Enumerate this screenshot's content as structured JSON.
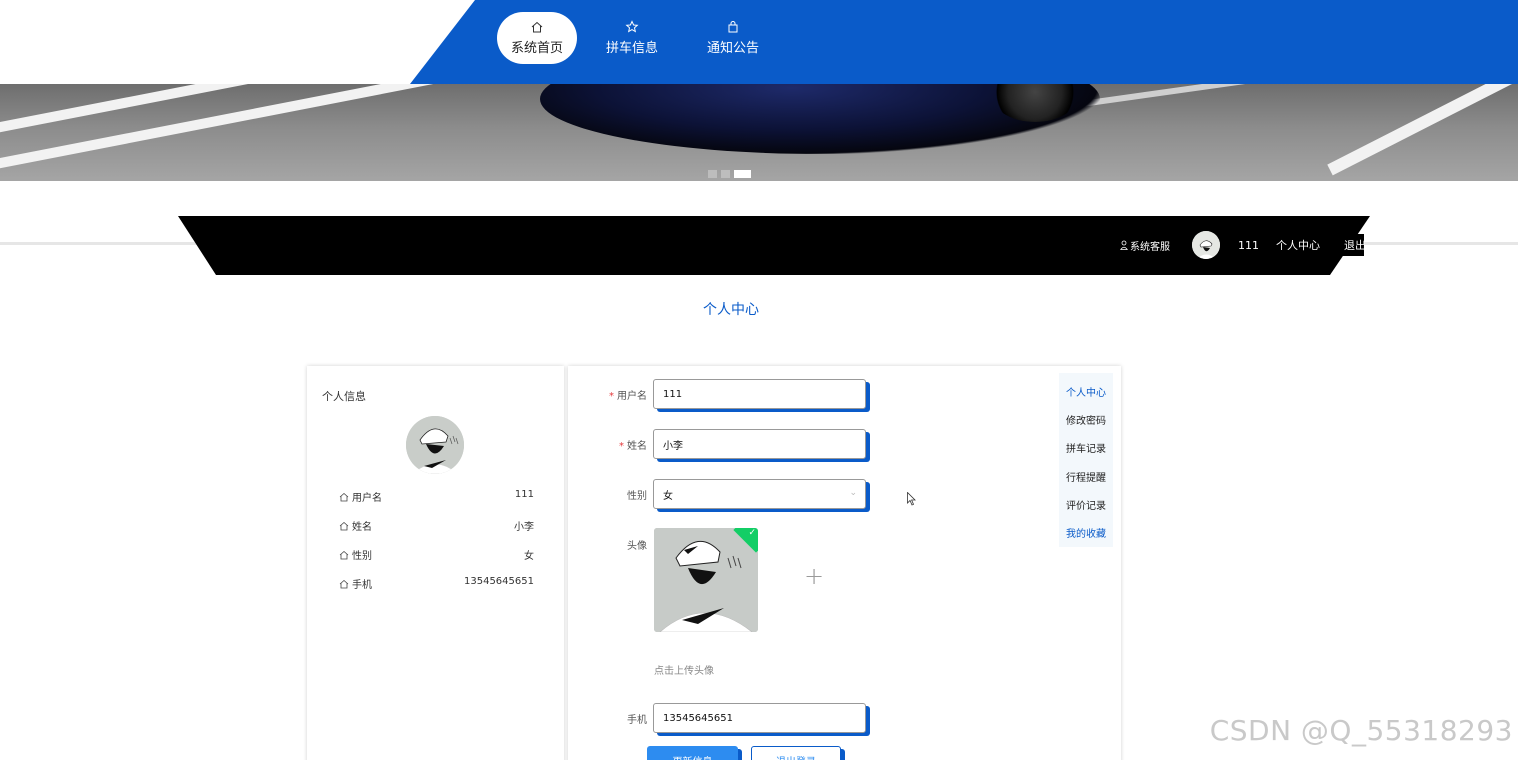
{
  "nav": {
    "items": [
      {
        "label": "系统首页",
        "icon": "home-icon",
        "active": true
      },
      {
        "label": "拼车信息",
        "icon": "star-icon",
        "active": false
      },
      {
        "label": "通知公告",
        "icon": "bag-icon",
        "active": false
      }
    ],
    "accent_color": "#0a5bc9"
  },
  "carousel": {
    "slides": 3,
    "active_index": 2
  },
  "userbar": {
    "service_label": "系统客服",
    "username": "111",
    "center_label": "个人中心",
    "logout_label": "退出"
  },
  "page": {
    "title": "个人中心"
  },
  "profile": {
    "title": "个人信息",
    "rows": [
      {
        "key": "用户名",
        "value": "111"
      },
      {
        "key": "姓名",
        "value": "小李"
      },
      {
        "key": "性别",
        "value": "女"
      },
      {
        "key": "手机",
        "value": "13545645651"
      }
    ]
  },
  "form": {
    "username": {
      "label": "用户名",
      "value": "111",
      "required": true
    },
    "name": {
      "label": "姓名",
      "value": "小李",
      "required": true
    },
    "gender": {
      "label": "性别",
      "value": "女"
    },
    "avatar": {
      "label": "头像",
      "hint": "点击上传头像"
    },
    "phone": {
      "label": "手机",
      "value": "13545645651"
    },
    "update_button": "更新信息",
    "logout_button": "退出登录"
  },
  "side_menu": [
    {
      "label": "个人中心",
      "active": true
    },
    {
      "label": "修改密码",
      "active": false
    },
    {
      "label": "拼车记录",
      "active": false
    },
    {
      "label": "行程提醒",
      "active": false
    },
    {
      "label": "评价记录",
      "active": false
    },
    {
      "label": "我的收藏",
      "active": false
    }
  ],
  "watermark": "CSDN @Q_55318293"
}
